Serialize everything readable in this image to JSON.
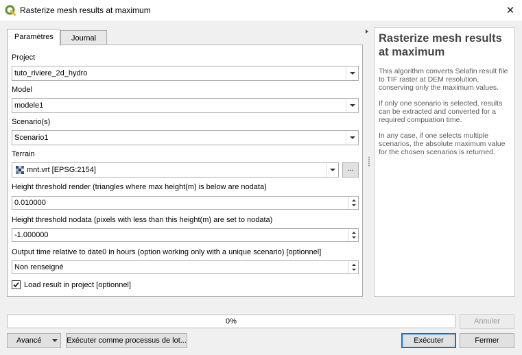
{
  "window": {
    "title": "Rasterize mesh results at maximum",
    "close_glyph": "✕"
  },
  "tabs": [
    {
      "label": "Paramètres",
      "active": true
    },
    {
      "label": "Journal",
      "active": false
    }
  ],
  "params": {
    "project": {
      "label": "Project",
      "value": "tuto_riviere_2d_hydro"
    },
    "model": {
      "label": "Model",
      "value": "modele1"
    },
    "scenario": {
      "label": "Scenario(s)",
      "value": "Scenario1"
    },
    "terrain": {
      "label": "Terrain",
      "value": "mnt.vrt [EPSG:2154]",
      "browse_label": "..."
    },
    "height_render": {
      "label": "Height threshold render (triangles where max height(m) is below are nodata)",
      "value": "0.010000"
    },
    "height_nodata": {
      "label": "Height threshold nodata (pixels with less than this height(m) are set to nodata)",
      "value": "-1.000000"
    },
    "output_time": {
      "label": "Output time relative to date0 in hours (option working only with a unique scenario) [optionnel]",
      "value": "Non renseigné"
    },
    "load_result": {
      "label": "Load result in project [optionnel]",
      "checked": true
    }
  },
  "help": {
    "title": "Rasterize mesh results at maximum",
    "paragraphs": [
      "This algorithm converts Selafin result file to TIF raster at DEM resolution, conserving only the maximum values.",
      "If only one scenario is selected, results can be extracted and converted for a required compuation time.",
      "In any case, if one selects multiple scenarios, the absolute maximum value for the chosen scenarios is returned."
    ]
  },
  "footer": {
    "progress_text": "0%",
    "progress_fraction": 0,
    "cancel_label": "Annuler",
    "advanced_label": "Avancé",
    "batch_label": "Exécuter comme processus de lot...",
    "run_label": "Exécuter",
    "close_label": "Fermer"
  },
  "colors": {
    "qgis_green": "#589632",
    "accent": "#0078d7"
  },
  "icons": [
    "qgis-logo-icon",
    "close-icon",
    "dropdown-arrow-icon",
    "raster-layer-icon",
    "spin-up-icon",
    "spin-down-icon",
    "checkbox-checked-icon"
  ]
}
